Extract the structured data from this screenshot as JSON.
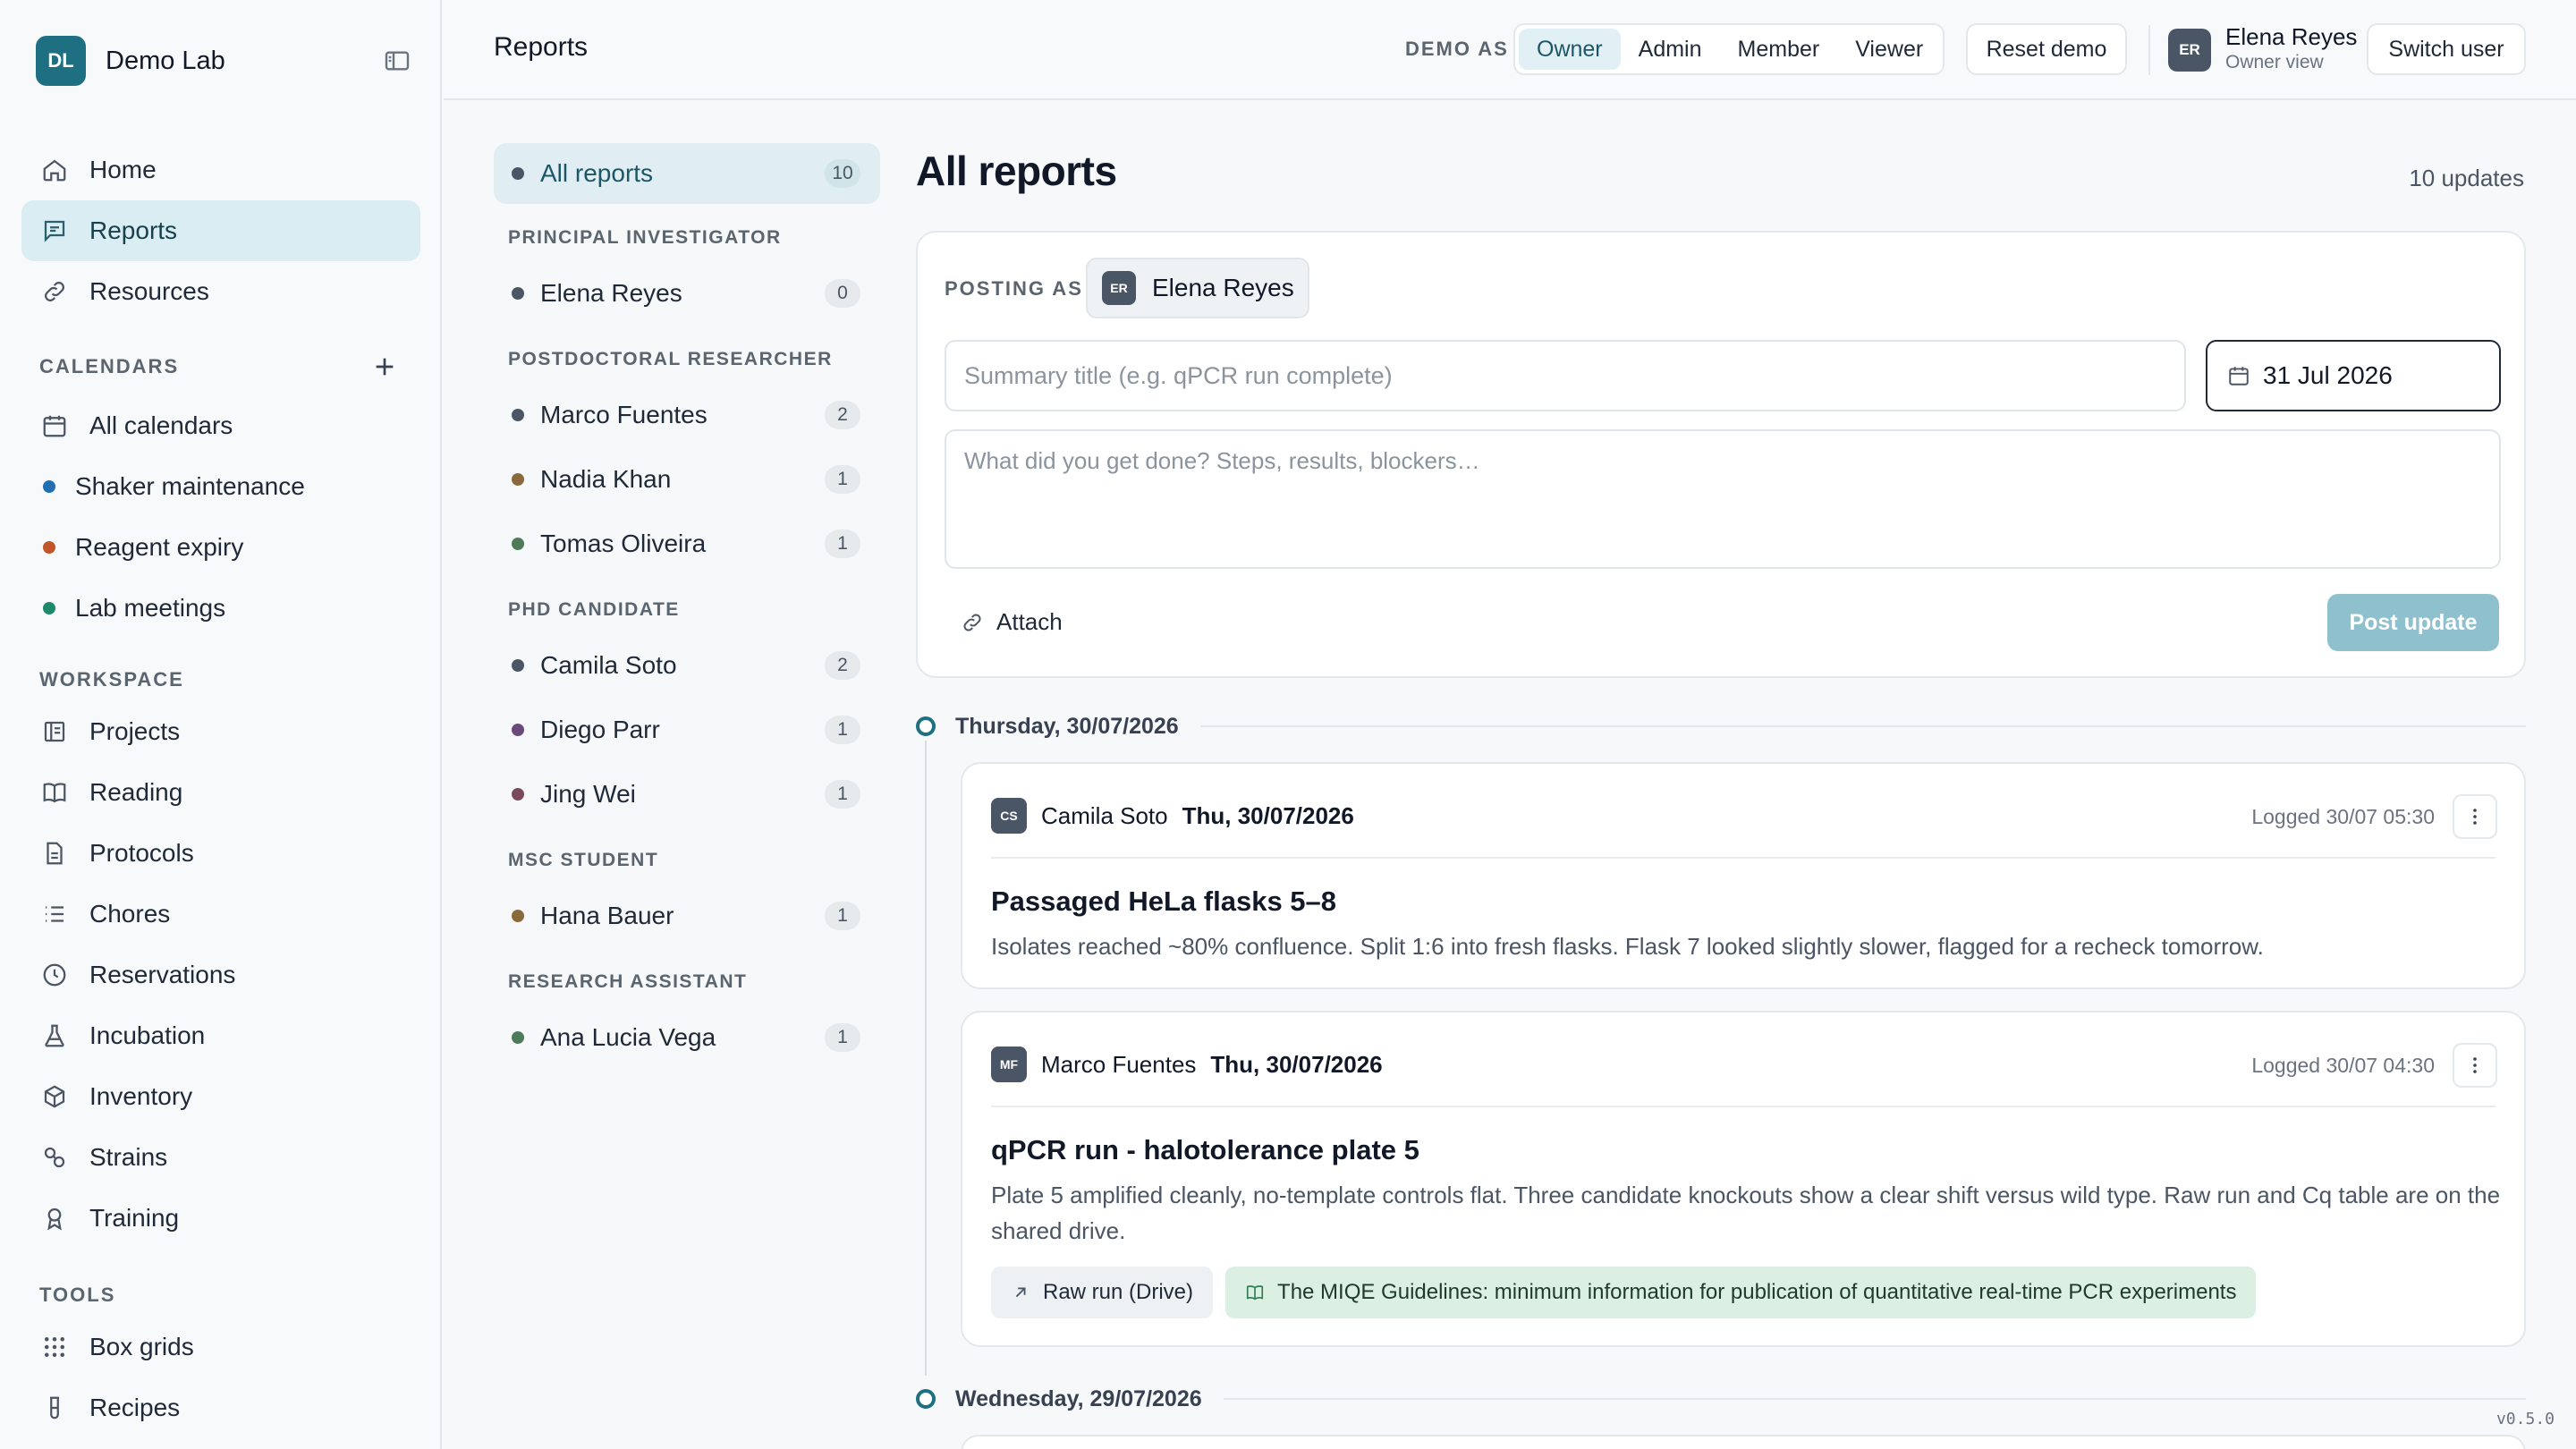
{
  "brand": {
    "initials": "DL",
    "name": "Demo Lab"
  },
  "nav": {
    "main": [
      {
        "label": "Home",
        "icon": "home-icon"
      },
      {
        "label": "Reports",
        "icon": "message-icon",
        "active": true
      },
      {
        "label": "Resources",
        "icon": "link-icon"
      }
    ],
    "calendars_label": "CALENDARS",
    "calendars": [
      {
        "label": "All calendars",
        "icon": "calendar-icon"
      },
      {
        "label": "Shaker maintenance",
        "color": "#1f6fb2"
      },
      {
        "label": "Reagent expiry",
        "color": "#c2562b"
      },
      {
        "label": "Lab meetings",
        "color": "#1f8a6a"
      }
    ],
    "workspace_label": "WORKSPACE",
    "workspace": [
      {
        "label": "Projects",
        "icon": "projects-icon"
      },
      {
        "label": "Reading",
        "icon": "book-icon"
      },
      {
        "label": "Protocols",
        "icon": "document-icon"
      },
      {
        "label": "Chores",
        "icon": "list-icon"
      },
      {
        "label": "Reservations",
        "icon": "clock-icon"
      },
      {
        "label": "Incubation",
        "icon": "flask-icon"
      },
      {
        "label": "Inventory",
        "icon": "box-icon"
      },
      {
        "label": "Strains",
        "icon": "strains-icon"
      },
      {
        "label": "Training",
        "icon": "award-icon"
      }
    ],
    "tools_label": "TOOLS",
    "tools": [
      {
        "label": "Box grids",
        "icon": "grid-icon"
      },
      {
        "label": "Recipes",
        "icon": "tube-icon"
      }
    ]
  },
  "topbar": {
    "title": "Reports",
    "demo_as": "DEMO AS",
    "roles": [
      "Owner",
      "Admin",
      "Member",
      "Viewer"
    ],
    "active_role": "Owner",
    "reset": "Reset demo",
    "user_initials": "ER",
    "user_name": "Elena Reyes",
    "user_role": "Owner view",
    "switch": "Switch user"
  },
  "filter": {
    "all": {
      "label": "All reports",
      "count": "10"
    },
    "groups": [
      {
        "label": "PRINCIPAL INVESTIGATOR",
        "people": [
          {
            "name": "Elena Reyes",
            "count": "0",
            "color": "#4a5665"
          }
        ]
      },
      {
        "label": "POSTDOCTORAL RESEARCHER",
        "people": [
          {
            "name": "Marco Fuentes",
            "count": "2",
            "color": "#4a5665"
          },
          {
            "name": "Nadia Khan",
            "count": "1",
            "color": "#8a6a3c"
          },
          {
            "name": "Tomas Oliveira",
            "count": "1",
            "color": "#4f7a5a"
          }
        ]
      },
      {
        "label": "PHD CANDIDATE",
        "people": [
          {
            "name": "Camila Soto",
            "count": "2",
            "color": "#4a5665"
          },
          {
            "name": "Diego Parr",
            "count": "1",
            "color": "#6a4a7a"
          },
          {
            "name": "Jing Wei",
            "count": "1",
            "color": "#7a4a5a"
          }
        ]
      },
      {
        "label": "MSC STUDENT",
        "people": [
          {
            "name": "Hana Bauer",
            "count": "1",
            "color": "#8a6a3c"
          }
        ]
      },
      {
        "label": "RESEARCH ASSISTANT",
        "people": [
          {
            "name": "Ana Lucia Vega",
            "count": "1",
            "color": "#4f7a5a"
          }
        ]
      }
    ]
  },
  "main": {
    "title": "All reports",
    "updates": "10 updates",
    "composer": {
      "posting_as": "POSTING AS",
      "poster_initials": "ER",
      "poster_name": "Elena Reyes",
      "title_placeholder": "Summary title (e.g. qPCR run complete)",
      "date": "31 Jul 2026",
      "body_placeholder": "What did you get done? Steps, results, blockers…",
      "attach": "Attach",
      "post": "Post update"
    },
    "days": [
      {
        "label": "Thursday, 30/07/2026"
      },
      {
        "label": "Wednesday, 29/07/2026"
      }
    ],
    "reports": [
      {
        "initials": "CS",
        "author": "Camila Soto",
        "date": "Thu, 30/07/2026",
        "logged": "Logged 30/07 05:30",
        "title": "Passaged HeLa flasks 5–8",
        "body": "Isolates reached ~80% confluence. Split 1:6 into fresh flasks. Flask 7 looked slightly slower, flagged for a recheck tomorrow."
      },
      {
        "initials": "MF",
        "author": "Marco Fuentes",
        "date": "Thu, 30/07/2026",
        "logged": "Logged 30/07 04:30",
        "title": "qPCR run - halotolerance plate 5",
        "body": "Plate 5 amplified cleanly, no-template controls flat. Three candidate knockouts show a clear shift versus wild type. Raw run and Cq table are on the shared drive.",
        "links": [
          {
            "label": "Raw run (Drive)",
            "icon": "external-link-icon"
          },
          {
            "label": "The MIQE Guidelines: minimum information for publication of quantitative real-time PCR experiments",
            "icon": "book-icon"
          }
        ]
      }
    ]
  },
  "version": "v0.5.0"
}
